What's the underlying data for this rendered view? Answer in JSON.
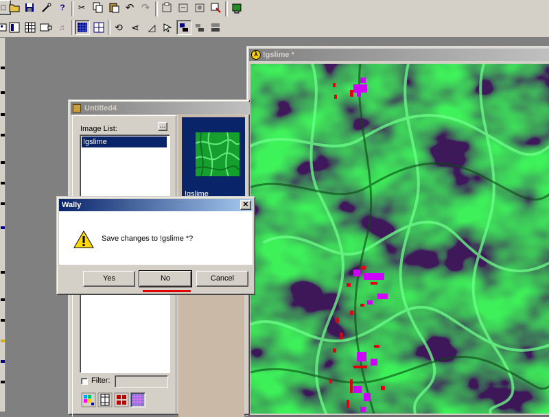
{
  "toolbar_top": {
    "buttons": [
      "new-icon",
      "open-icon",
      "save-icon",
      "wand-icon",
      "help-icon",
      "cut-icon",
      "copy-icon",
      "paste-icon",
      "undo-icon",
      "redo-icon",
      "tool-a-icon",
      "tool-b-icon",
      "tool-c-icon",
      "tool-d-icon",
      "run-icon"
    ]
  },
  "toolbar_second": {
    "buttons": [
      "view-a-icon",
      "view-b-icon",
      "view-c-icon",
      "view-d-icon",
      "grid-a-icon",
      "grid-b-icon",
      "rotate-icon",
      "mirror-icon",
      "flip-icon",
      "arrow-icon",
      "tile-a-icon",
      "tile-b-icon",
      "tile-c-icon"
    ]
  },
  "texture_window": {
    "title": "!gslime *",
    "icon": "half-life-lambda-icon"
  },
  "wad_window": {
    "title": "Untitled4",
    "icon": "package-icon",
    "image_list_label": "Image List:",
    "browse_label": "...",
    "images": [
      "!gslime"
    ],
    "preview_label": "!gslime",
    "filter_label": "Filter:",
    "filter_value": ""
  },
  "dialog": {
    "title": "Wally",
    "message": "Save changes to !gslime *?",
    "icon": "warning-icon",
    "buttons": {
      "yes": "Yes",
      "no": "No",
      "cancel": "Cancel"
    },
    "close_label": "✕"
  },
  "colors": {
    "accent_title": "#0a246a",
    "dialog_underline": "#e00000",
    "slime_dark": "#0b6b1a",
    "slime_light": "#39e85a"
  }
}
